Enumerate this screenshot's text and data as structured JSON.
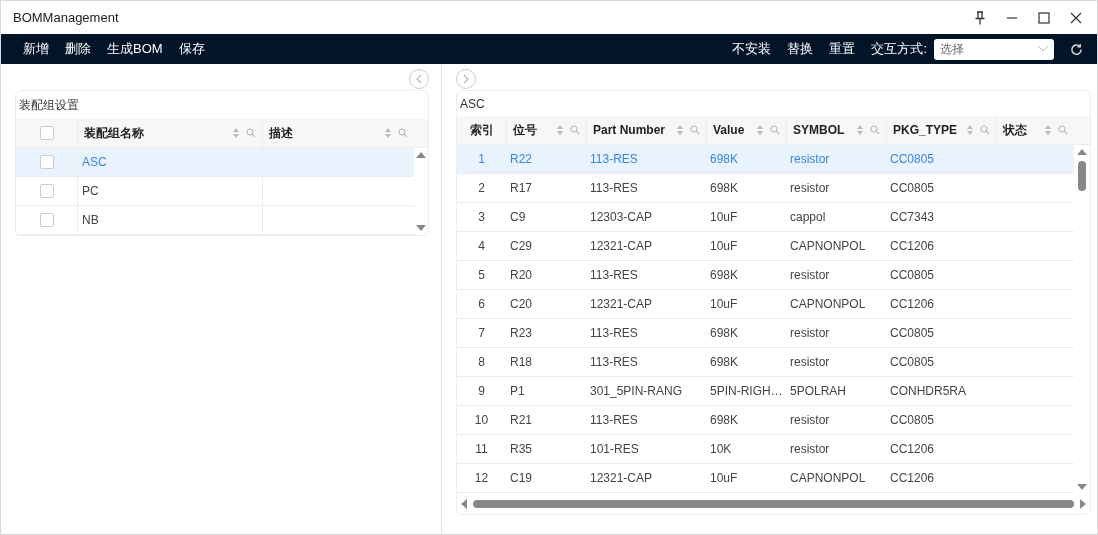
{
  "window": {
    "title": "BOMManagement"
  },
  "toolbar": {
    "left_actions": [
      "新增",
      "删除",
      "生成BOM",
      "保存"
    ],
    "right_actions": [
      "不安装",
      "替换",
      "重置"
    ],
    "mode_label": "交互方式:",
    "mode_select": {
      "placeholder": "选择"
    }
  },
  "assembly_panel": {
    "title": "装配组设置",
    "select_all_checked": false,
    "columns": [
      "装配组名称",
      "描述"
    ],
    "rows": [
      {
        "name": "ASC",
        "description": "",
        "checked": false,
        "selected": true
      },
      {
        "name": "PC",
        "description": "",
        "checked": false,
        "selected": false
      },
      {
        "name": "NB",
        "description": "",
        "checked": false,
        "selected": false
      }
    ]
  },
  "bom_panel": {
    "title": "ASC",
    "columns": [
      "索引",
      "位号",
      "Part Number",
      "Value",
      "SYMBOL",
      "PKG_TYPE",
      "状态"
    ],
    "rows": [
      {
        "cells": [
          "1",
          "R22",
          "113-RES",
          "698K",
          "resistor",
          "CC0805"
        ],
        "selected": true
      },
      {
        "cells": [
          "2",
          "R17",
          "113-RES",
          "698K",
          "resistor",
          "CC0805"
        ],
        "selected": false
      },
      {
        "cells": [
          "3",
          "C9",
          "12303-CAP",
          "10uF",
          "cappol",
          "CC7343"
        ],
        "selected": false
      },
      {
        "cells": [
          "4",
          "C29",
          "12321-CAP",
          "10uF",
          "CAPNONPOL",
          "CC1206"
        ],
        "selected": false
      },
      {
        "cells": [
          "5",
          "R20",
          "113-RES",
          "698K",
          "resistor",
          "CC0805"
        ],
        "selected": false
      },
      {
        "cells": [
          "6",
          "C20",
          "12321-CAP",
          "10uF",
          "CAPNONPOL",
          "CC1206"
        ],
        "selected": false
      },
      {
        "cells": [
          "7",
          "R23",
          "113-RES",
          "698K",
          "resistor",
          "CC0805"
        ],
        "selected": false
      },
      {
        "cells": [
          "8",
          "R18",
          "113-RES",
          "698K",
          "resistor",
          "CC0805"
        ],
        "selected": false
      },
      {
        "cells": [
          "9",
          "P1",
          "301_5PIN-RANG",
          "5PIN-RIGH…",
          "5POLRAH",
          "CONHDR5RA"
        ],
        "selected": false
      },
      {
        "cells": [
          "10",
          "R21",
          "113-RES",
          "698K",
          "resistor",
          "CC0805"
        ],
        "selected": false
      },
      {
        "cells": [
          "11",
          "R35",
          "101-RES",
          "10K",
          "resistor",
          "CC1206"
        ],
        "selected": false
      },
      {
        "cells": [
          "12",
          "C19",
          "12321-CAP",
          "10uF",
          "CAPNONPOL",
          "CC1206"
        ],
        "selected": false
      }
    ]
  }
}
